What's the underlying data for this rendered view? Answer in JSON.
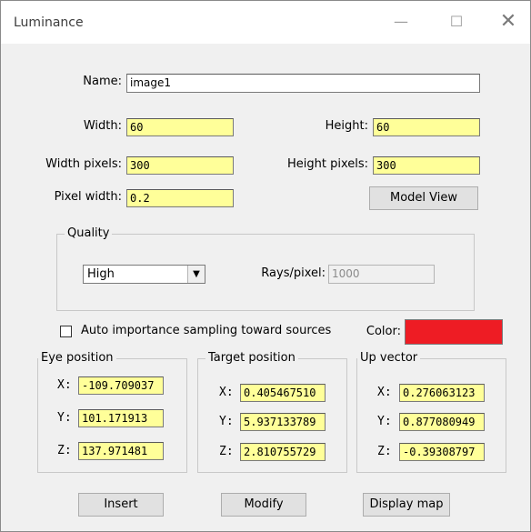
{
  "window": {
    "title": "Luminance",
    "minimize_glyph": "—",
    "maximize_glyph": "☐",
    "close_glyph": "✕"
  },
  "form": {
    "name_label": "Name:",
    "name_value": "image1",
    "width_label": "Width:",
    "width_value": "60",
    "height_label": "Height:",
    "height_value": "60",
    "width_pixels_label": "Width pixels:",
    "width_pixels_value": "300",
    "height_pixels_label": "Height pixels:",
    "height_pixels_value": "300",
    "pixel_width_label": "Pixel width:",
    "pixel_width_value": "0.2",
    "model_view_button": "Model View"
  },
  "quality": {
    "group_title": "Quality",
    "selected": "High",
    "rays_label": "Rays/pixel:",
    "rays_value": "1000"
  },
  "sampling": {
    "checkbox_label": "Auto importance sampling toward sources",
    "checked": false,
    "color_label": "Color:",
    "color_value": "#ee1c24"
  },
  "eye": {
    "group_title": "Eye position",
    "x_label": "X:",
    "x_value": "-109.709037",
    "y_label": "Y:",
    "y_value": "101.171913",
    "z_label": "Z:",
    "z_value": "137.971481"
  },
  "target": {
    "group_title": "Target position",
    "x_label": "X:",
    "x_value": "0.405467510",
    "y_label": "Y:",
    "y_value": "5.937133789",
    "z_label": "Z:",
    "z_value": "2.810755729"
  },
  "up": {
    "group_title": "Up vector",
    "x_label": "X:",
    "x_value": "0.276063123",
    "y_label": "Y:",
    "y_value": "0.877080949",
    "z_label": "Z:",
    "z_value": "-0.39308797"
  },
  "buttons": {
    "insert": "Insert",
    "modify": "Modify",
    "display_map": "Display map"
  }
}
